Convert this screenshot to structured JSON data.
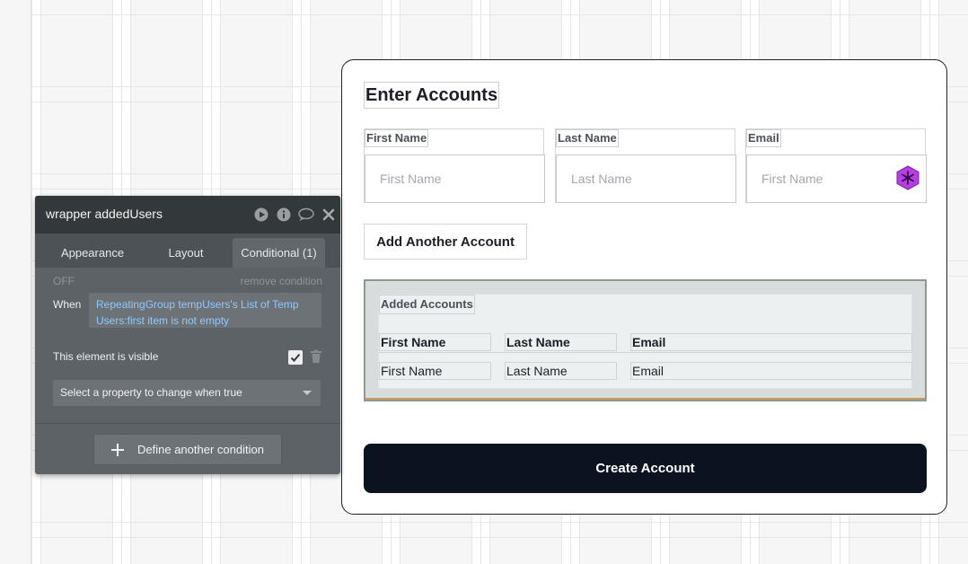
{
  "card": {
    "title": "Enter Accounts",
    "fields": [
      {
        "label": "First Name",
        "placeholder": "First Name"
      },
      {
        "label": "Last Name",
        "placeholder": "Last Name"
      },
      {
        "label": "Email",
        "placeholder": "First Name"
      }
    ],
    "add_button": "Add Another Account",
    "added": {
      "title": "Added Accounts",
      "headers": [
        "First Name",
        "Last Name",
        "Email"
      ],
      "row": [
        "First Name",
        "Last Name",
        "Email"
      ]
    },
    "create_button": "Create Account"
  },
  "panel": {
    "title": "wrapper addedUsers",
    "tabs": [
      "Appearance",
      "Layout",
      "Conditional (1)"
    ],
    "active_tab": "Conditional (1)",
    "off_label": "OFF",
    "remove_condition": "remove condition",
    "when_label": "When",
    "expression": "RepeatingGroup tempUsers's List of Temp Users:first item is not empty",
    "visible_label": "This element is visible",
    "visible_checked": true,
    "select_placeholder": "Select a property to change when true",
    "define_button": "Define another condition"
  },
  "icons": {
    "header": [
      "play-icon",
      "info-icon",
      "comment-icon",
      "close-icon"
    ],
    "plugin": "hexagon-plugin-icon"
  },
  "colors": {
    "create_button_bg": "#0b1220",
    "expression_text": "#8fc9ff",
    "panel_bg": "#5d6266",
    "panel_header_bg": "#33383b",
    "plugin_icon": "#b53fe0"
  }
}
